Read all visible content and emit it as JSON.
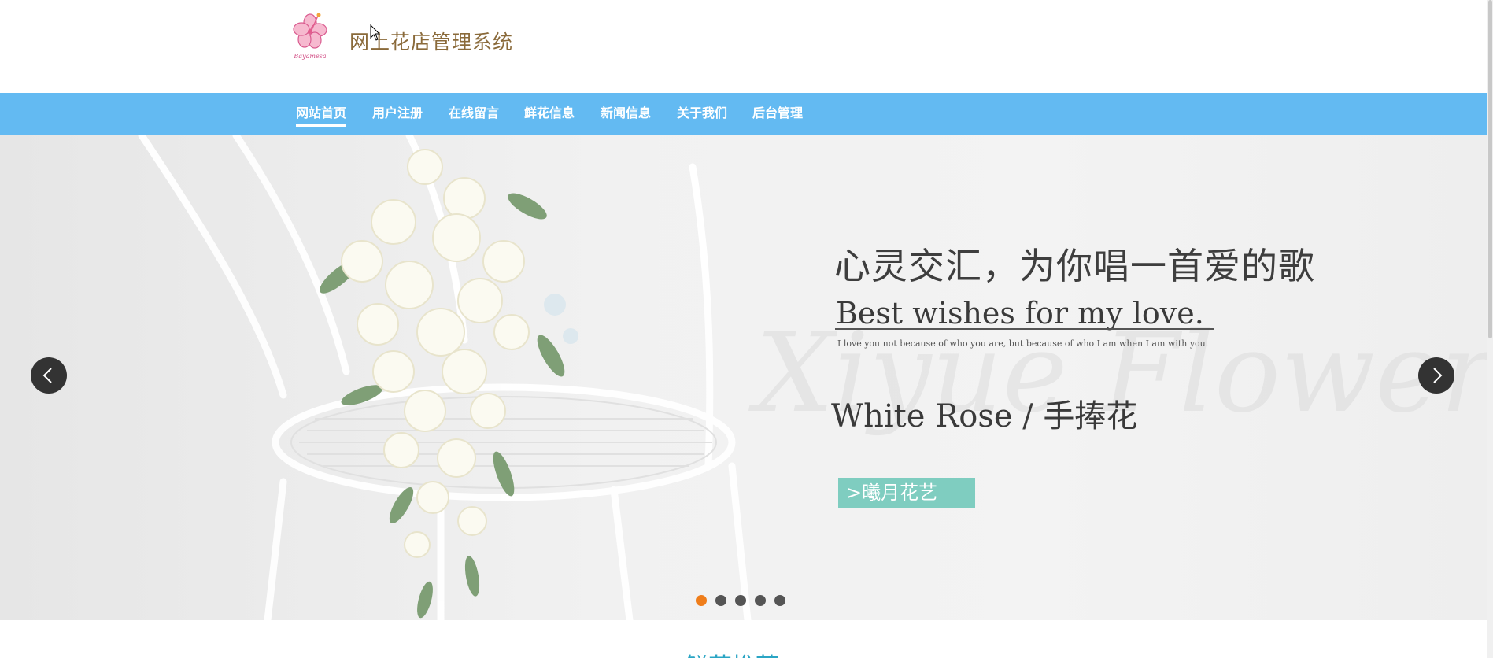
{
  "header": {
    "title": "网上花店管理系统",
    "logo_text": "Bayamesa"
  },
  "nav": {
    "items": [
      {
        "label": "网站首页",
        "active": true
      },
      {
        "label": "用户注册",
        "active": false
      },
      {
        "label": "在线留言",
        "active": false
      },
      {
        "label": "鲜花信息",
        "active": false
      },
      {
        "label": "新闻信息",
        "active": false
      },
      {
        "label": "关于我们",
        "active": false
      },
      {
        "label": "后台管理",
        "active": false
      }
    ]
  },
  "banner": {
    "headline": "心灵交汇，为你唱一首爱的歌",
    "subhead": "Best wishes for my love.",
    "quote": "I love you not because of who you are, but because of who I am when I am with you.",
    "watermark": "Xiyue Flower",
    "product": "White Rose / 手捧花",
    "tag": ">曦月花艺",
    "prev_icon": "chevron-left-icon",
    "next_icon": "chevron-right-icon",
    "slide_count": 5,
    "active_slide": 1
  },
  "colors": {
    "nav_bg": "#63baf2",
    "dot_active": "#ef7d1a",
    "dot_inactive": "#555555",
    "tag_bg": "#7fcdc0"
  }
}
